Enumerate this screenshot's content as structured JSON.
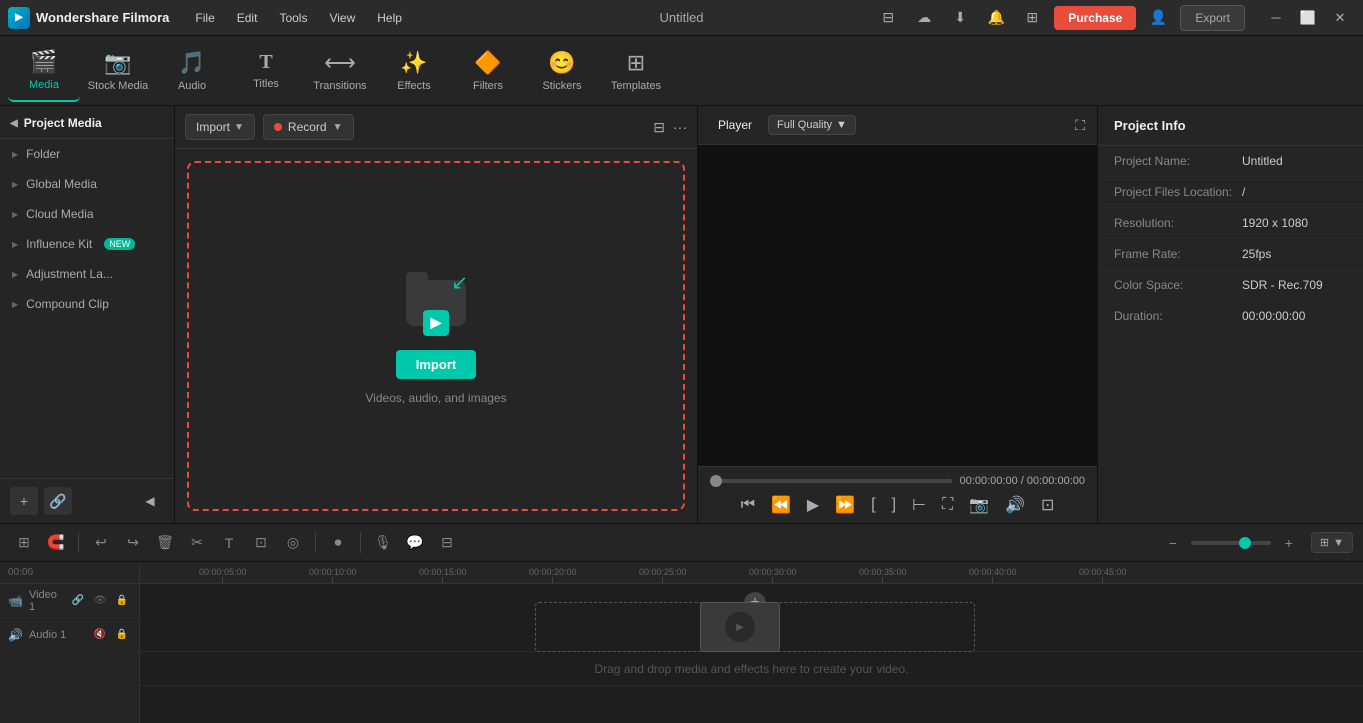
{
  "titlebar": {
    "app_name": "Wondershare Filmora",
    "menu": [
      "File",
      "Edit",
      "Tools",
      "View",
      "Help"
    ],
    "title": "Untitled",
    "purchase_label": "Purchase",
    "export_label": "Export"
  },
  "toolbar": {
    "items": [
      {
        "id": "media",
        "label": "Media",
        "icon": "🎬",
        "active": true
      },
      {
        "id": "stock-media",
        "label": "Stock Media",
        "icon": "📷"
      },
      {
        "id": "audio",
        "label": "Audio",
        "icon": "🎵"
      },
      {
        "id": "titles",
        "label": "Titles",
        "icon": "T"
      },
      {
        "id": "transitions",
        "label": "Transitions",
        "icon": "⟷"
      },
      {
        "id": "effects",
        "label": "Effects",
        "icon": "✨"
      },
      {
        "id": "filters",
        "label": "Filters",
        "icon": "🔶"
      },
      {
        "id": "stickers",
        "label": "Stickers",
        "icon": "😊"
      },
      {
        "id": "templates",
        "label": "Templates",
        "icon": "⊞"
      }
    ]
  },
  "left_panel": {
    "header": "Project Media",
    "items": [
      {
        "label": "Folder"
      },
      {
        "label": "Global Media"
      },
      {
        "label": "Cloud Media"
      },
      {
        "label": "Influence Kit",
        "badge": "NEW"
      },
      {
        "label": "Adjustment La..."
      },
      {
        "label": "Compound Clip"
      }
    ]
  },
  "media_panel": {
    "import_label": "Import",
    "record_label": "Record",
    "drop_zone": {
      "import_btn": "Import",
      "hint": "Videos, audio, and images"
    }
  },
  "player": {
    "tab_player": "Player",
    "quality": "Full Quality",
    "time_current": "00:00:00:00",
    "time_total": "00:00:00:00"
  },
  "project_info": {
    "title": "Project Info",
    "fields": [
      {
        "label": "Project Name:",
        "value": "Untitled"
      },
      {
        "label": "Project Files Location:",
        "value": "/"
      },
      {
        "label": "Resolution:",
        "value": "1920 x 1080"
      },
      {
        "label": "Frame Rate:",
        "value": "25fps"
      },
      {
        "label": "Color Space:",
        "value": "SDR - Rec.709"
      },
      {
        "label": "Duration:",
        "value": "00:00:00:00"
      }
    ]
  },
  "timeline": {
    "tracks": [
      {
        "label": "Video 1",
        "type": "video"
      },
      {
        "label": "Audio 1",
        "type": "audio"
      }
    ],
    "ruler_marks": [
      "00:00:05:00",
      "00:00:10:00",
      "00:00:15:00",
      "00:00:20:00",
      "00:00:25:00",
      "00:00:30:00",
      "00:00:35:00",
      "00:00:40:00",
      "00:00:45:00"
    ],
    "drag_hint": "Drag and drop media and effects here to create your video."
  }
}
